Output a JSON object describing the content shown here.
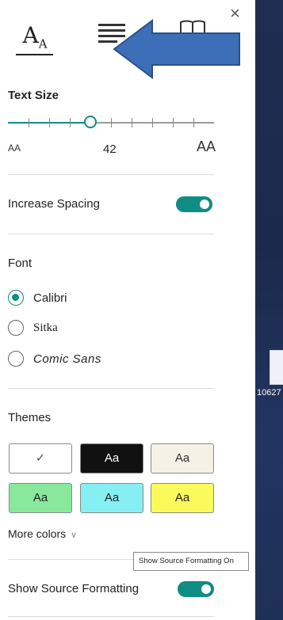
{
  "tabs": {
    "text_preferences_glyph": "A",
    "text_preferences_glyph_sub": "A"
  },
  "close_label": "×",
  "text_size": {
    "heading": "Text Size",
    "value": "42",
    "small_aa": "AA",
    "large_aa": "AA",
    "level_fraction": 0.4
  },
  "increase_spacing": {
    "label": "Increase Spacing",
    "enabled": true
  },
  "font": {
    "heading": "Font",
    "options": [
      {
        "label": "Calibri",
        "selected": true
      },
      {
        "label": "Sitka",
        "selected": false
      },
      {
        "label": "Comic Sans",
        "selected": false
      }
    ]
  },
  "themes": {
    "heading": "Themes",
    "swatches": [
      {
        "label": "✓",
        "bg": "#ffffff",
        "fg": "#555555"
      },
      {
        "label": "Aa",
        "bg": "#111111",
        "fg": "#ffffff"
      },
      {
        "label": "Aa",
        "bg": "#f6f1e6",
        "fg": "#333333"
      },
      {
        "label": "Aa",
        "bg": "#88e89c",
        "fg": "#222222"
      },
      {
        "label": "Aa",
        "bg": "#86eff3",
        "fg": "#222222"
      },
      {
        "label": "Aa",
        "bg": "#fafa5a",
        "fg": "#222222"
      }
    ],
    "more_colors": "More colors"
  },
  "source_formatting": {
    "label": "Show Source Formatting",
    "tooltip": "Show Source Formatting On",
    "enabled": true
  },
  "desktop": {
    "file_label": "10627"
  },
  "colors": {
    "accent": "#0f8c84",
    "arrow": "#3d6fb8"
  }
}
